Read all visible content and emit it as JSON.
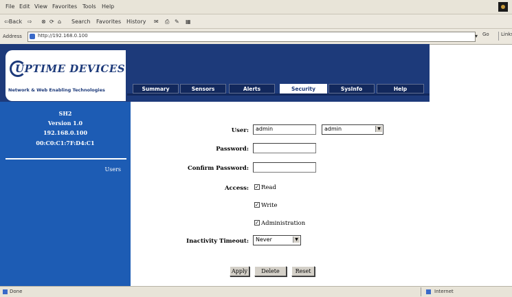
{
  "browser": {
    "menu": [
      "File",
      "Edit",
      "View",
      "Favorites",
      "Tools",
      "Help"
    ],
    "toolbar": {
      "back": "⇦Back",
      "forward": "⇨",
      "stop": "⊗",
      "refresh": "⟳",
      "home": "⌂",
      "search": "Search",
      "favorites": "Favorites",
      "history": "History",
      "mail": "✉",
      "print": "⎙",
      "edit": "✎",
      "discuss": "▦"
    },
    "address_label": "Address",
    "address_value": "http://192.168.0.100",
    "go_label": "Go",
    "links_label": "Links",
    "status_text": "Done",
    "zone_text": "Internet"
  },
  "brand": {
    "logo_text": "UPTIME DEVICES",
    "tagline": "Network & Web Enabling Technologies"
  },
  "tabs": [
    {
      "label": "Summary",
      "active": false
    },
    {
      "label": "Sensors",
      "active": false
    },
    {
      "label": "Alerts",
      "active": false
    },
    {
      "label": "Security",
      "active": true
    },
    {
      "label": "SysInfo",
      "active": false
    },
    {
      "label": "Help",
      "active": false
    }
  ],
  "sidebar": {
    "device": "SH2",
    "version": "Version 1.0",
    "ip": "192.168.0.100",
    "mac": "00:C0:C1:7F:D4:C1",
    "link": "Users"
  },
  "form": {
    "user_label": "User:",
    "user_value": "admin",
    "user_select": "admin",
    "password_label": "Password:",
    "confirm_label": "Confirm Password:",
    "access_label": "Access:",
    "access_options": [
      {
        "label": "Read",
        "checked": true
      },
      {
        "label": "Write",
        "checked": true
      },
      {
        "label": "Administration",
        "checked": true
      }
    ],
    "timeout_label": "Inactivity Timeout:",
    "timeout_value": "Never",
    "buttons": {
      "apply": "Apply",
      "delete": "Delete",
      "reset": "Reset"
    }
  },
  "colors": {
    "banner": "#1d3a7a",
    "sidebar": "#1d5cb4"
  }
}
